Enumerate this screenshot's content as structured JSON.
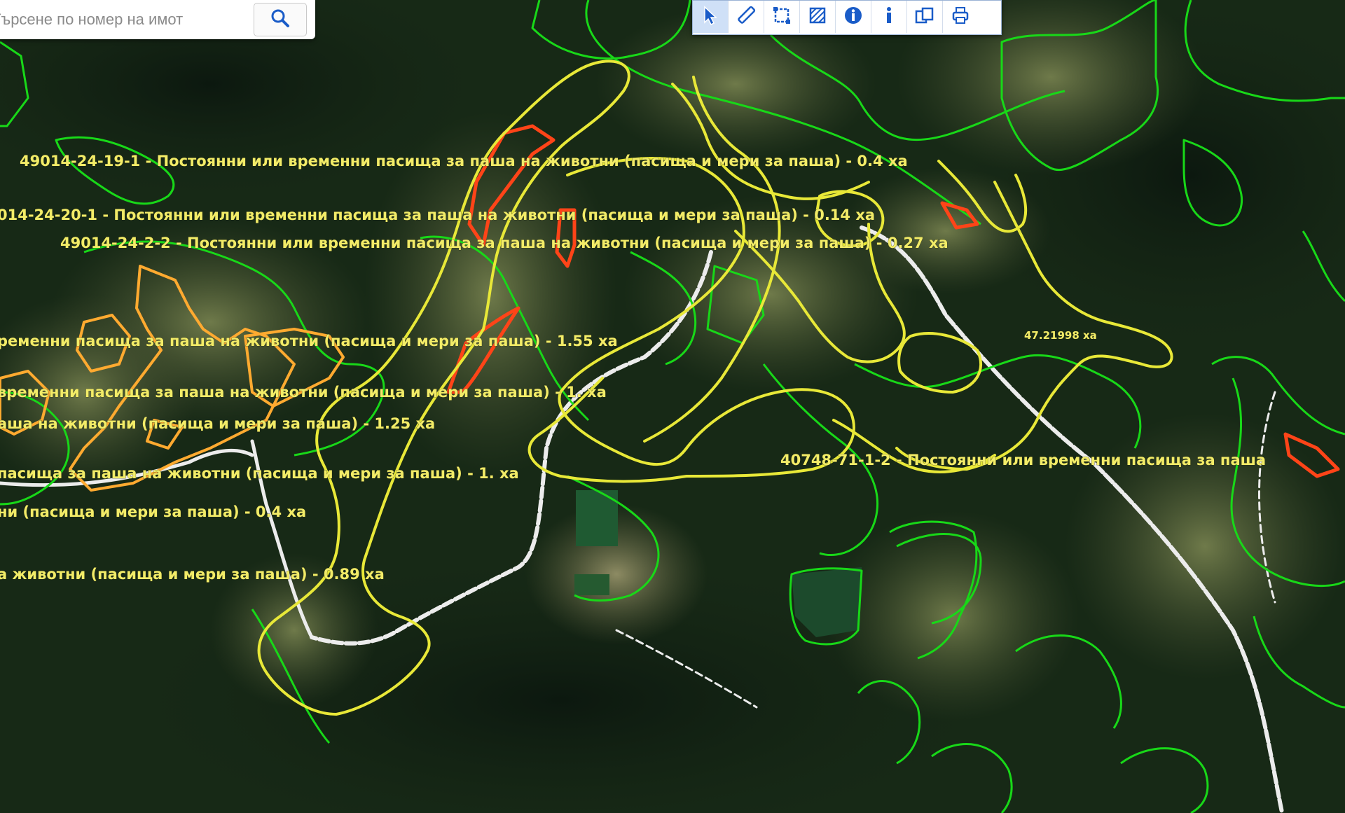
{
  "search": {
    "placeholder": "Търсене по номер на имот"
  },
  "toolbar": {
    "tools": [
      {
        "icon": "pointer-arrow-icon"
      },
      {
        "icon": "ruler-icon"
      },
      {
        "icon": "area-measure-icon"
      },
      {
        "icon": "hatched-polygon-icon"
      },
      {
        "icon": "info-circle-icon"
      },
      {
        "icon": "info-icon"
      },
      {
        "icon": "layers-icon"
      },
      {
        "icon": "print-icon"
      }
    ]
  },
  "map": {
    "colors": {
      "label": "#f2ec68",
      "boundary_green": "#18d818",
      "boundary_yellow": "#e8e838",
      "boundary_red": "#ff4418",
      "boundary_orange": "#ffaa30",
      "road": "#ececec"
    },
    "labels": [
      "49014-24-19-1 - Постоянни или временни пасища за паша на животни (пасища и мери за паша) - 0.4 ха",
      "014-24-20-1 - Постоянни или временни пасища за паша на животни (пасища и мери за паша) - 0.14 ха",
      "49014-24-2-2 - Постоянни или временни пасища за паша на животни (пасища и мери за паша) - 0.27 ха",
      "ременни пасища за паша на животни (пасища и мери за паша) - 1.55 ха",
      "временни пасища за паша на животни (пасища и мери за паша) - 1. ха",
      "аша на животни (пасища и мери за паша) - 1.25 ха",
      "пасища за паша на животни (пасища и мери за паша) - 1. ха",
      "ни (пасища и мери за паша) - 0.4 ха",
      "а животни (пасища и мери за паша) - 0.89 ха",
      "40748-71-1-2 - Постоянни или временни пасища за паша",
      "47.21998 ха"
    ]
  }
}
